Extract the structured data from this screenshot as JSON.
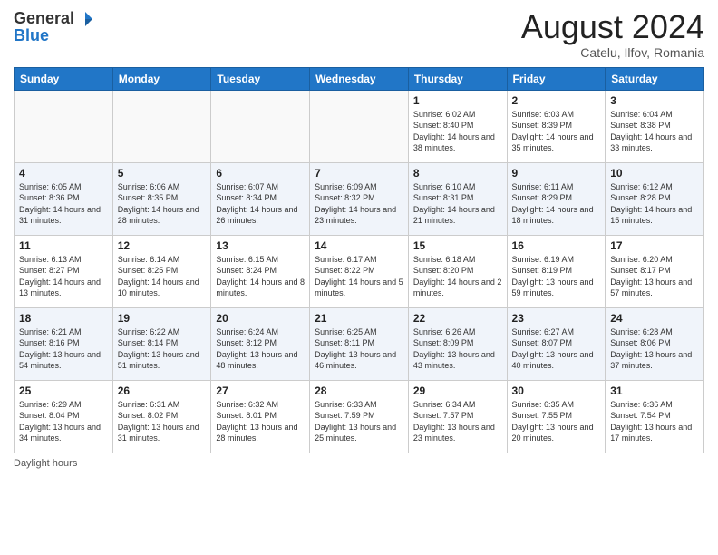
{
  "header": {
    "logo_general": "General",
    "logo_blue": "Blue",
    "month_title": "August 2024",
    "location": "Catelu, Ilfov, Romania"
  },
  "days_of_week": [
    "Sunday",
    "Monday",
    "Tuesday",
    "Wednesday",
    "Thursday",
    "Friday",
    "Saturday"
  ],
  "footer": {
    "daylight_label": "Daylight hours"
  },
  "weeks": [
    {
      "days": [
        {
          "num": "",
          "info": ""
        },
        {
          "num": "",
          "info": ""
        },
        {
          "num": "",
          "info": ""
        },
        {
          "num": "",
          "info": ""
        },
        {
          "num": "1",
          "info": "Sunrise: 6:02 AM\nSunset: 8:40 PM\nDaylight: 14 hours\nand 38 minutes."
        },
        {
          "num": "2",
          "info": "Sunrise: 6:03 AM\nSunset: 8:39 PM\nDaylight: 14 hours\nand 35 minutes."
        },
        {
          "num": "3",
          "info": "Sunrise: 6:04 AM\nSunset: 8:38 PM\nDaylight: 14 hours\nand 33 minutes."
        }
      ]
    },
    {
      "days": [
        {
          "num": "4",
          "info": "Sunrise: 6:05 AM\nSunset: 8:36 PM\nDaylight: 14 hours\nand 31 minutes."
        },
        {
          "num": "5",
          "info": "Sunrise: 6:06 AM\nSunset: 8:35 PM\nDaylight: 14 hours\nand 28 minutes."
        },
        {
          "num": "6",
          "info": "Sunrise: 6:07 AM\nSunset: 8:34 PM\nDaylight: 14 hours\nand 26 minutes."
        },
        {
          "num": "7",
          "info": "Sunrise: 6:09 AM\nSunset: 8:32 PM\nDaylight: 14 hours\nand 23 minutes."
        },
        {
          "num": "8",
          "info": "Sunrise: 6:10 AM\nSunset: 8:31 PM\nDaylight: 14 hours\nand 21 minutes."
        },
        {
          "num": "9",
          "info": "Sunrise: 6:11 AM\nSunset: 8:29 PM\nDaylight: 14 hours\nand 18 minutes."
        },
        {
          "num": "10",
          "info": "Sunrise: 6:12 AM\nSunset: 8:28 PM\nDaylight: 14 hours\nand 15 minutes."
        }
      ]
    },
    {
      "days": [
        {
          "num": "11",
          "info": "Sunrise: 6:13 AM\nSunset: 8:27 PM\nDaylight: 14 hours\nand 13 minutes."
        },
        {
          "num": "12",
          "info": "Sunrise: 6:14 AM\nSunset: 8:25 PM\nDaylight: 14 hours\nand 10 minutes."
        },
        {
          "num": "13",
          "info": "Sunrise: 6:15 AM\nSunset: 8:24 PM\nDaylight: 14 hours\nand 8 minutes."
        },
        {
          "num": "14",
          "info": "Sunrise: 6:17 AM\nSunset: 8:22 PM\nDaylight: 14 hours\nand 5 minutes."
        },
        {
          "num": "15",
          "info": "Sunrise: 6:18 AM\nSunset: 8:20 PM\nDaylight: 14 hours\nand 2 minutes."
        },
        {
          "num": "16",
          "info": "Sunrise: 6:19 AM\nSunset: 8:19 PM\nDaylight: 13 hours\nand 59 minutes."
        },
        {
          "num": "17",
          "info": "Sunrise: 6:20 AM\nSunset: 8:17 PM\nDaylight: 13 hours\nand 57 minutes."
        }
      ]
    },
    {
      "days": [
        {
          "num": "18",
          "info": "Sunrise: 6:21 AM\nSunset: 8:16 PM\nDaylight: 13 hours\nand 54 minutes."
        },
        {
          "num": "19",
          "info": "Sunrise: 6:22 AM\nSunset: 8:14 PM\nDaylight: 13 hours\nand 51 minutes."
        },
        {
          "num": "20",
          "info": "Sunrise: 6:24 AM\nSunset: 8:12 PM\nDaylight: 13 hours\nand 48 minutes."
        },
        {
          "num": "21",
          "info": "Sunrise: 6:25 AM\nSunset: 8:11 PM\nDaylight: 13 hours\nand 46 minutes."
        },
        {
          "num": "22",
          "info": "Sunrise: 6:26 AM\nSunset: 8:09 PM\nDaylight: 13 hours\nand 43 minutes."
        },
        {
          "num": "23",
          "info": "Sunrise: 6:27 AM\nSunset: 8:07 PM\nDaylight: 13 hours\nand 40 minutes."
        },
        {
          "num": "24",
          "info": "Sunrise: 6:28 AM\nSunset: 8:06 PM\nDaylight: 13 hours\nand 37 minutes."
        }
      ]
    },
    {
      "days": [
        {
          "num": "25",
          "info": "Sunrise: 6:29 AM\nSunset: 8:04 PM\nDaylight: 13 hours\nand 34 minutes."
        },
        {
          "num": "26",
          "info": "Sunrise: 6:31 AM\nSunset: 8:02 PM\nDaylight: 13 hours\nand 31 minutes."
        },
        {
          "num": "27",
          "info": "Sunrise: 6:32 AM\nSunset: 8:01 PM\nDaylight: 13 hours\nand 28 minutes."
        },
        {
          "num": "28",
          "info": "Sunrise: 6:33 AM\nSunset: 7:59 PM\nDaylight: 13 hours\nand 25 minutes."
        },
        {
          "num": "29",
          "info": "Sunrise: 6:34 AM\nSunset: 7:57 PM\nDaylight: 13 hours\nand 23 minutes."
        },
        {
          "num": "30",
          "info": "Sunrise: 6:35 AM\nSunset: 7:55 PM\nDaylight: 13 hours\nand 20 minutes."
        },
        {
          "num": "31",
          "info": "Sunrise: 6:36 AM\nSunset: 7:54 PM\nDaylight: 13 hours\nand 17 minutes."
        }
      ]
    }
  ]
}
